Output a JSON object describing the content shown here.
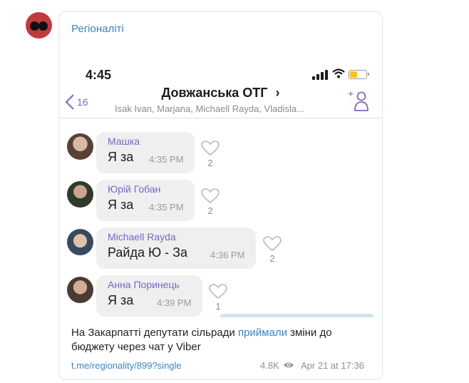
{
  "post": {
    "channel_name": "Регіоналіті",
    "caption_before": "На Закарпатті депутати сільради ",
    "caption_link": "приймали",
    "caption_after": " зміни до бюджету через чат у Viber",
    "link_url": "t.me/regionality/899?single",
    "views": "4.8K",
    "date": "Apr 21 at 17:36"
  },
  "screenshot": {
    "status_time": "4:45",
    "back_count": "16",
    "chat_title": "Довжанська ОТГ",
    "chat_title_chevron": "›",
    "chat_members": "Isak Ivan, Marjana, Michaell Rayda, Vladisla...",
    "messages": [
      {
        "author": "Машка",
        "text": "Я за",
        "time": "4:35 PM",
        "likes": "2"
      },
      {
        "author": "Юрій Гобан",
        "text": "Я за",
        "time": "4:35 PM",
        "likes": "2"
      },
      {
        "author": "Michaell Rayda",
        "text": "Райда Ю - За",
        "time": "4:36 PM",
        "likes": "2"
      },
      {
        "author": "Анна Поринець",
        "text": "Я за",
        "time": "4:39 PM",
        "likes": "1"
      }
    ]
  },
  "icons": {
    "channel_avatar": "red-circle-with-eyes",
    "back": "chevron-left-icon",
    "add_member": "add-person-icon",
    "like": "heart-outline-icon",
    "views": "eye-icon"
  },
  "colors": {
    "accent": "#3a85c3",
    "viber_purple": "#7b67c1",
    "avatar_red": "#c23a3f",
    "battery": "#f2c61a"
  }
}
